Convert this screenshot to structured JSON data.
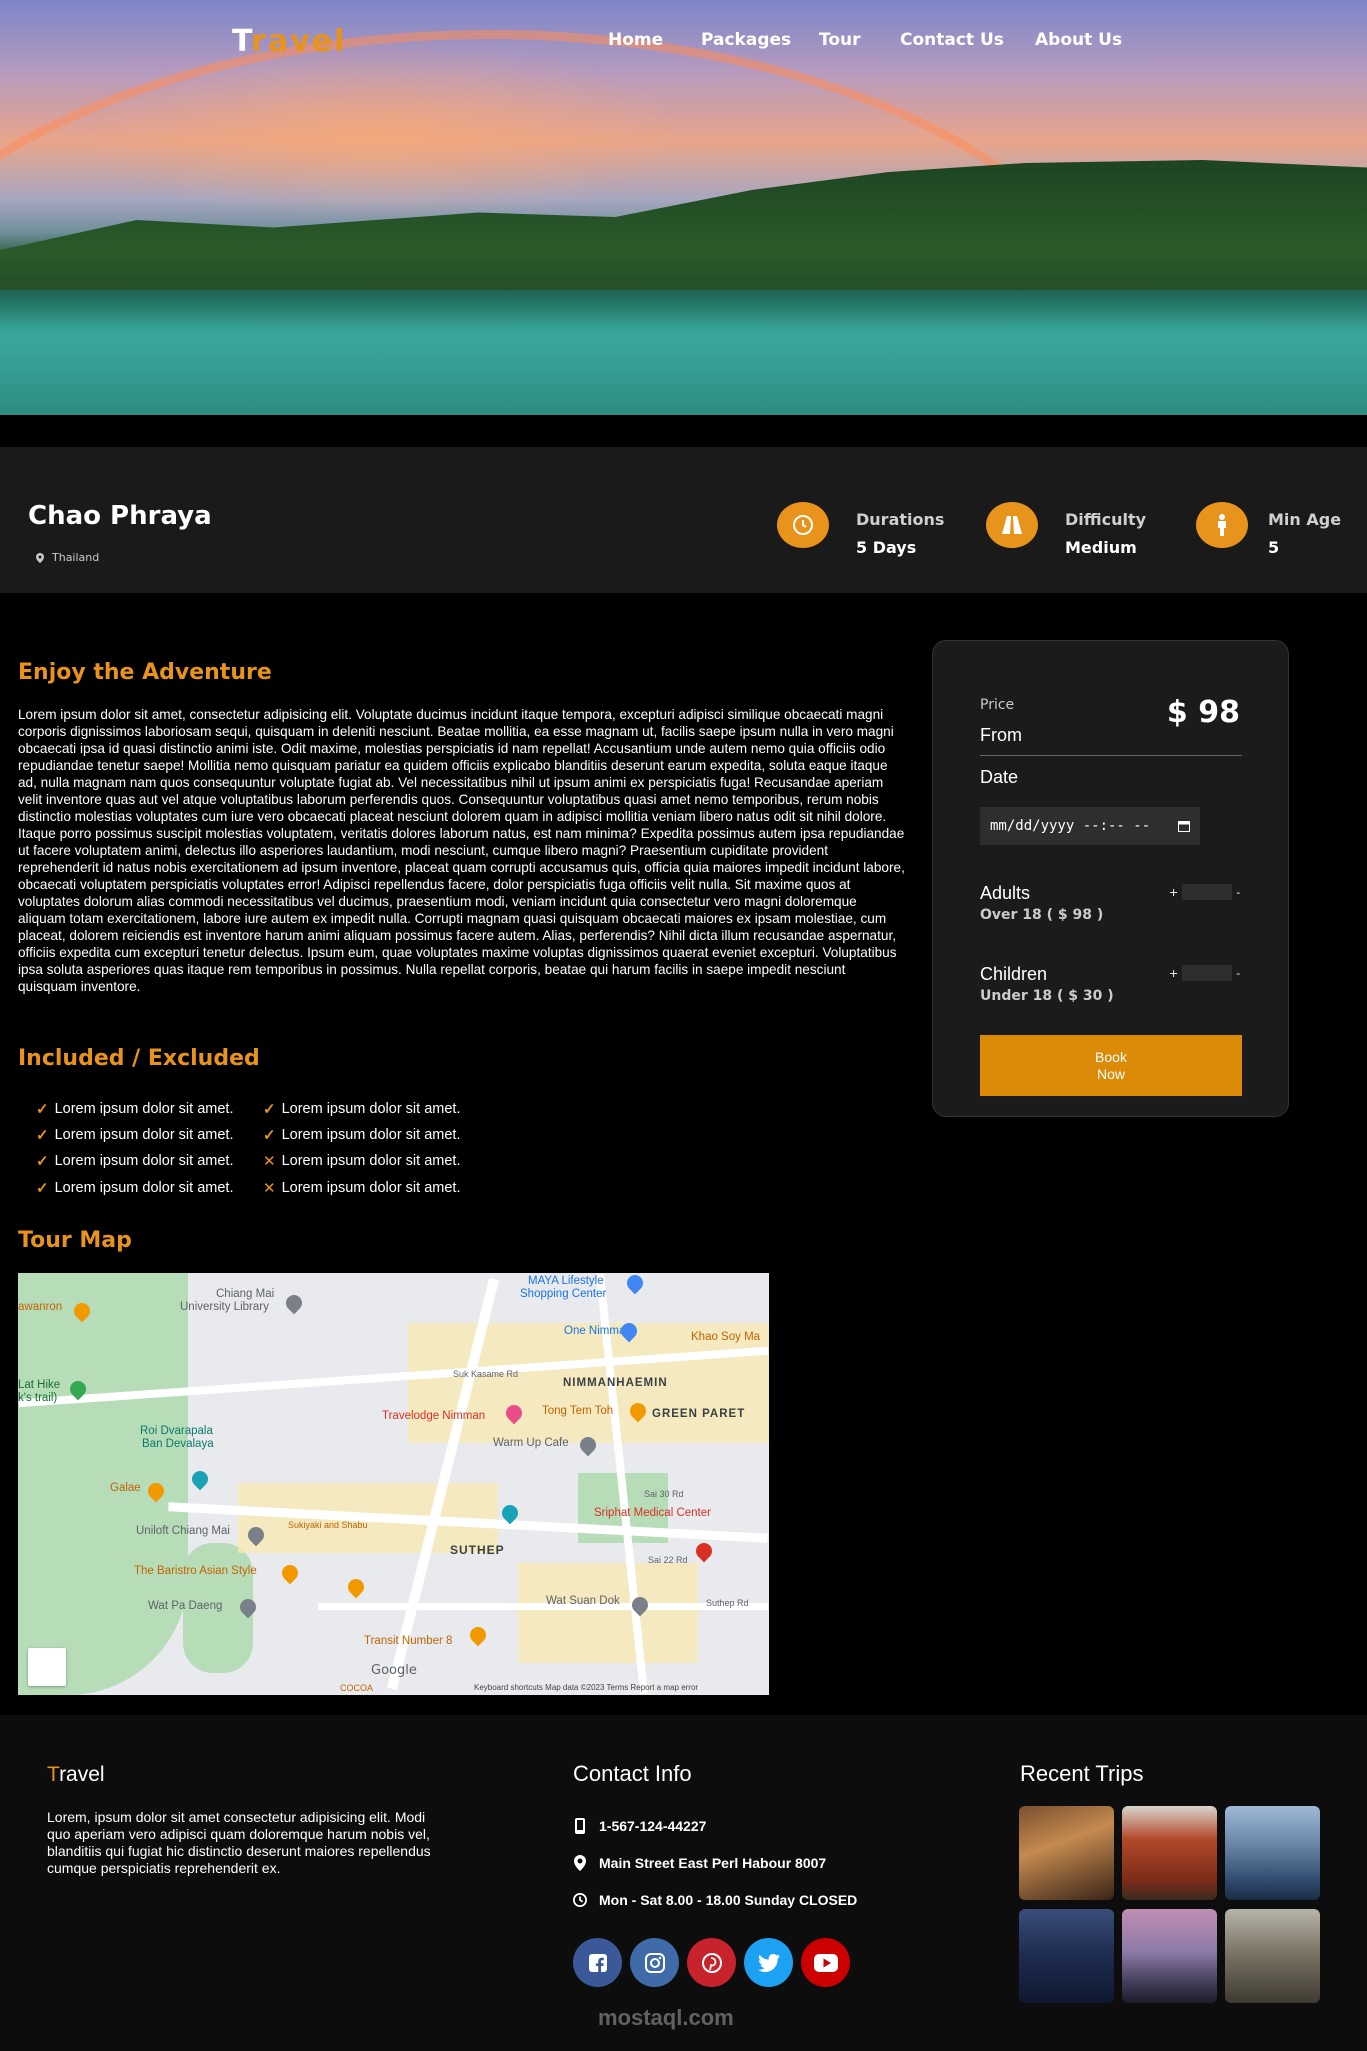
{
  "header": {
    "logo_first": "T",
    "logo_rest": "ravel",
    "nav": [
      "Home",
      "Packages",
      "Tour",
      "Contact Us",
      "About Us"
    ]
  },
  "tour": {
    "name": "Chao Phraya",
    "location": "Thailand",
    "stats": [
      {
        "icon": "clock-icon",
        "label": "Durations",
        "value": "5 Days"
      },
      {
        "icon": "road-icon",
        "label": "Difficulty",
        "value": "Medium"
      },
      {
        "icon": "person-icon",
        "label": "Min Age",
        "value": "5"
      }
    ]
  },
  "content": {
    "adventure_title": "Enjoy the Adventure",
    "adventure_text": "Lorem ipsum dolor sit amet, consectetur adipisicing elit. Voluptate ducimus incidunt itaque tempora, excepturi adipisci similique obcaecati magni corporis dignissimos laboriosam sequi, quisquam in deleniti nesciunt. Beatae mollitia, ea esse magnam ut, facilis saepe ipsum nulla in vero magni obcaecati ipsa id quasi distinctio animi iste. Odit maxime, molestias perspiciatis id nam repellat! Accusantium unde autem nemo quia officiis odio repudiandae tenetur saepe! Mollitia nemo quisquam pariatur ea quidem officiis explicabo blanditiis deserunt earum expedita, soluta eaque itaque ad, nulla magnam nam quos consequuntur voluptate fugiat ab. Vel necessitatibus nihil ut ipsum animi ex perspiciatis fuga! Recusandae aperiam velit inventore quas aut vel atque voluptatibus laborum perferendis quos. Consequuntur voluptatibus quasi amet nemo temporibus, rerum nobis distinctio molestias voluptates cum iure vero obcaecati placeat nesciunt dolorem quam in adipisci mollitia veniam libero natus odit sit nihil dolore. Itaque porro possimus suscipit molestias voluptatem, veritatis dolores laborum natus, est nam minima? Expedita possimus autem ipsa repudiandae ut facere voluptatem animi, delectus illo asperiores laudantium, modi nesciunt, cumque libero magni? Praesentium cupiditate provident reprehenderit id natus nobis exercitationem ad ipsum inventore, placeat quam corrupti accusamus quis, officia quia maiores impedit incidunt labore, obcaecati voluptatem perspiciatis voluptates error! Adipisci repellendus facere, dolor perspiciatis fuga officiis velit nulla. Sit maxime quos at voluptates dolorum alias commodi necessitatibus vel ducimus, praesentium modi, veniam incidunt quia consectetur vero magni doloremque aliquam totam exercitationem, labore iure autem ex impedit nulla. Corrupti magnam quasi quisquam obcaecati maiores ex ipsam molestiae, cum placeat, dolorem reiciendis est inventore harum animi aliquam possimus facere autem. Alias, perferendis? Nihil dicta illum recusandae aspernatur, officiis expedita cum excepturi tenetur delectus. Ipsum eum, quae voluptates maxime voluptas dignissimos quaerat eveniet excepturi. Voluptatibus ipsa soluta asperiores quas itaque rem temporibus in possimus. Nulla repellat corporis, beatae qui harum facilis in saepe impedit nesciunt quisquam inventore.",
    "included_title": "Included / Excluded",
    "included": [
      {
        "mark": "✓",
        "text": "Lorem ipsum dolor sit amet."
      },
      {
        "mark": "✓",
        "text": "Lorem ipsum dolor sit amet."
      },
      {
        "mark": "✓",
        "text": "Lorem ipsum dolor sit amet."
      },
      {
        "mark": "✓",
        "text": "Lorem ipsum dolor sit amet."
      }
    ],
    "excluded": [
      {
        "mark": "✓",
        "text": "Lorem ipsum dolor sit amet."
      },
      {
        "mark": "✓",
        "text": "Lorem ipsum dolor sit amet."
      },
      {
        "mark": "✕",
        "text": "Lorem ipsum dolor sit amet."
      },
      {
        "mark": "✕",
        "text": "Lorem ipsum dolor sit amet."
      }
    ],
    "map_title": "Tour Map"
  },
  "map": {
    "labels": {
      "maya": "MAYA Lifestyle",
      "maya2": "Shopping Center",
      "chiang": "Chiang Mai",
      "chiang2": "University Library",
      "oneNimman": "One Nimman",
      "khao": "Khao Soy Ma",
      "nimman": "NIMMANHAEMIN",
      "travelodge": "Travelodge Nimman",
      "tongtem": "Tong Tem Toh",
      "green": "GREEN PARET",
      "latHike": "Lat Hike",
      "latHike2": "k's trail)",
      "roi": "Roi Dvarapala",
      "roi2": "Ban Devalaya",
      "warmup": "Warm Up Cafe",
      "galae": "Galae",
      "uniloft": "Uniloft Chiang Mai",
      "sukiyaki": "Sukiyaki and Shabu",
      "sriphat": "Sriphat Medical Center",
      "suthep": "SUTHEP",
      "baristro": "The Baristro Asian Style",
      "watpa": "Wat Pa Daeng",
      "watsuan": "Wat Suan Dok",
      "transit": "Transit Number 8",
      "soi30": "Sai 30 Rd",
      "soi22": "Sai 22 Rd",
      "suthepRd": "Suthep Rd",
      "sukKasame": "Suk Kasame Rd",
      "kawanron": "awanron",
      "cocoa": "COCOA"
    },
    "google": "Google",
    "footer": "Keyboard shortcuts     Map data ©2023     Terms     Report a map error"
  },
  "booking": {
    "price_label": "Price",
    "from_label": "From",
    "price": "$ 98",
    "date_label": "Date",
    "date_placeholder": "mm/dd/yyyy --:-- --",
    "adults_label": "Adults",
    "adults_sub": "Over 18 ( $ 98 )",
    "children_label": "Children",
    "children_sub": "Under 18 ( $ 30 )",
    "plus": "+",
    "minus": "-",
    "book_line1": "Book",
    "book_line2": "Now"
  },
  "footer": {
    "logo_first": "T",
    "logo_rest": "ravel",
    "about": "Lorem, ipsum dolor sit amet consectetur adipisicing elit. Modi quo aperiam vero adipisci quam doloremque harum nobis vel, blanditiis qui fugiat hic distinctio deserunt maiores repellendus cumque perspiciatis reprehenderit ex.",
    "contact_title": "Contact Info",
    "phone": "1-567-124-44227",
    "address": "Main Street East Perl Habour 8007",
    "hours": "Mon - Sat 8.00 - 18.00 Sunday CLOSED",
    "recent_title": "Recent Trips",
    "watermark": "mostaql.com",
    "colors": {
      "accent": "#e8931b",
      "facebook": "#3b5998",
      "instagram": "#3f6ba8",
      "pinterest": "#c8232c",
      "twitter": "#1da1f2",
      "youtube": "#cc0000"
    }
  }
}
